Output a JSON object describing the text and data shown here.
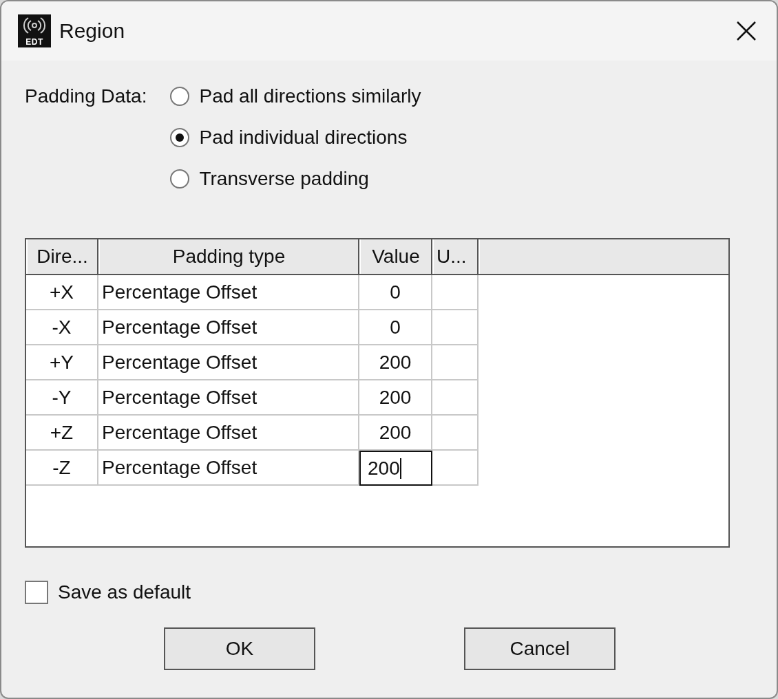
{
  "window": {
    "title": "Region",
    "logo_text": "EDT"
  },
  "padding_data": {
    "label": "Padding Data:",
    "options": [
      {
        "label": "Pad all directions similarly",
        "selected": false
      },
      {
        "label": "Pad individual directions",
        "selected": true
      },
      {
        "label": "Transverse padding",
        "selected": false
      }
    ]
  },
  "table": {
    "columns": [
      "Dire...",
      "Padding type",
      "Value",
      "U..."
    ],
    "rows": [
      {
        "direction": "+X",
        "padding_type": "Percentage Offset",
        "value": "0",
        "editing": false
      },
      {
        "direction": "-X",
        "padding_type": "Percentage Offset",
        "value": "0",
        "editing": false
      },
      {
        "direction": "+Y",
        "padding_type": "Percentage Offset",
        "value": "200",
        "editing": false
      },
      {
        "direction": "-Y",
        "padding_type": "Percentage Offset",
        "value": "200",
        "editing": false
      },
      {
        "direction": "+Z",
        "padding_type": "Percentage Offset",
        "value": "200",
        "editing": false
      },
      {
        "direction": "-Z",
        "padding_type": "Percentage Offset",
        "value": "200",
        "editing": true
      }
    ]
  },
  "save_default": {
    "label": "Save as default",
    "checked": false
  },
  "buttons": [
    "OK",
    "Cancel"
  ]
}
